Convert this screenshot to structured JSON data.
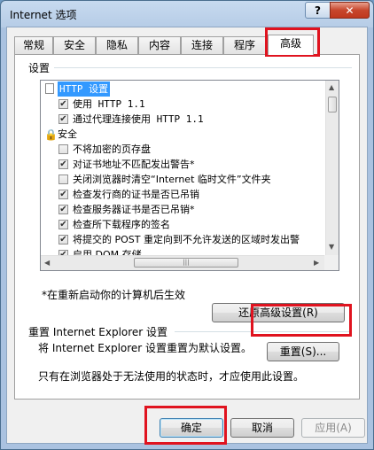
{
  "window": {
    "title": "Internet 选项",
    "help_label": "?",
    "close_label": "✕"
  },
  "tabs": [
    {
      "label": "常规"
    },
    {
      "label": "安全"
    },
    {
      "label": "隐私"
    },
    {
      "label": "内容"
    },
    {
      "label": "连接"
    },
    {
      "label": "程序"
    },
    {
      "label": "高级"
    }
  ],
  "settings": {
    "group_label": "设置",
    "items": [
      {
        "kind": "category",
        "icon": "page-icon",
        "label": "HTTP 设置",
        "selected": true
      },
      {
        "kind": "checkbox",
        "checked": true,
        "label": "使用 HTTP 1.1"
      },
      {
        "kind": "checkbox",
        "checked": true,
        "label": "通过代理连接使用 HTTP 1.1"
      },
      {
        "kind": "category",
        "icon": "lock-icon",
        "label": "安全"
      },
      {
        "kind": "checkbox",
        "checked": false,
        "label": "不将加密的页存盘"
      },
      {
        "kind": "checkbox",
        "checked": true,
        "label": "对证书地址不匹配发出警告*"
      },
      {
        "kind": "checkbox",
        "checked": false,
        "label": "关闭浏览器时清空“Internet 临时文件”文件夹"
      },
      {
        "kind": "checkbox",
        "checked": true,
        "label": "检查发行商的证书是否已吊销"
      },
      {
        "kind": "checkbox",
        "checked": true,
        "label": "检查服务器证书是否已吊销*"
      },
      {
        "kind": "checkbox",
        "checked": true,
        "label": "检查所下载程序的签名"
      },
      {
        "kind": "checkbox",
        "checked": true,
        "label": "将提交的 POST 重定向到不允许发送的区域时发出警"
      },
      {
        "kind": "checkbox",
        "checked": true,
        "label": "启用 DOM 存储"
      }
    ],
    "restart_note": "*在重新启动你的计算机后生效",
    "restore_button": "还原高级设置(R)"
  },
  "reset": {
    "group_label": "重置 Internet Explorer 设置",
    "description": "将 Internet Explorer 设置重置为默认设置。",
    "reset_button": "重置(S)...",
    "note": "只有在浏览器处于无法使用的状态时，才应使用此设置。"
  },
  "footer": {
    "ok_button": "确定",
    "cancel_button": "取消",
    "apply_button": "应用(A)"
  },
  "highlight_color": "#e0131f"
}
